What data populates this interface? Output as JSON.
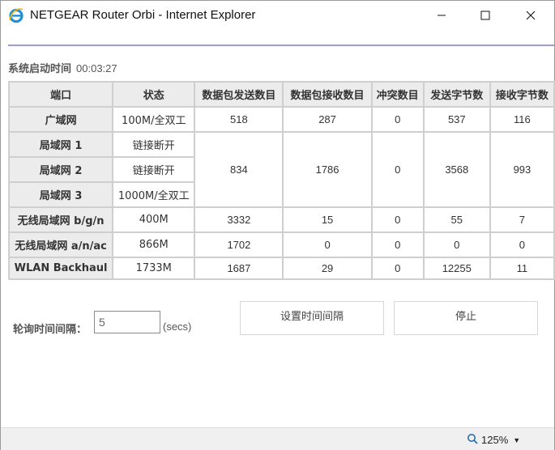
{
  "window": {
    "title": "NETGEAR Router Orbi - Internet Explorer",
    "accent_color": "#9d9cd6"
  },
  "uptime": {
    "label": "系统启动时间",
    "value": "00:03:27"
  },
  "table": {
    "headers": [
      "端口",
      "状态",
      "数据包发送数目",
      "数据包接收数目",
      "冲突数目",
      "发送字节数",
      "接收字节数"
    ],
    "wan": {
      "port": "广域网",
      "status": "100M/全双工",
      "tx_pkts": "518",
      "rx_pkts": "287",
      "collisions": "0",
      "tx_bytes": "537",
      "rx_bytes": "116"
    },
    "lan": {
      "ports": [
        {
          "port": "局域网 1",
          "status": "链接断开"
        },
        {
          "port": "局域网 2",
          "status": "链接断开"
        },
        {
          "port": "局域网 3",
          "status": "1000M/全双工"
        }
      ],
      "tx_pkts": "834",
      "rx_pkts": "1786",
      "collisions": "0",
      "tx_bytes": "3568",
      "rx_bytes": "993"
    },
    "wlan_bgn": {
      "port": "无线局域网 b/g/n",
      "status": "400M",
      "tx_pkts": "3332",
      "rx_pkts": "15",
      "collisions": "0",
      "tx_bytes": "55",
      "rx_bytes": "7"
    },
    "wlan_anac": {
      "port": "无线局域网 a/n/ac",
      "status": "866M",
      "tx_pkts": "1702",
      "rx_pkts": "0",
      "collisions": "0",
      "tx_bytes": "0",
      "rx_bytes": "0"
    },
    "backhaul": {
      "port": "WLAN Backhaul",
      "status": "1733M",
      "tx_pkts": "1687",
      "rx_pkts": "29",
      "collisions": "0",
      "tx_bytes": "12255",
      "rx_bytes": "11"
    }
  },
  "poll": {
    "label": "轮询时间间隔：",
    "value": "5",
    "unit": "(secs)",
    "set_button": "设置时间间隔",
    "stop_button": "停止"
  },
  "statusbar": {
    "zoom": "125%"
  },
  "icons": {
    "app": "internet-explorer-icon",
    "minimize": "minimize-icon",
    "maximize": "maximize-icon",
    "close": "close-icon",
    "zoom": "zoom-icon",
    "dropdown": "chevron-down-icon"
  }
}
